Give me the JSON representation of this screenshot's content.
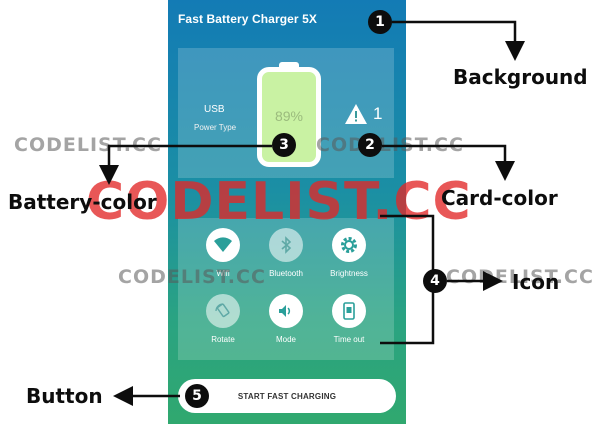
{
  "app": {
    "title": "Fast Battery Charger 5X",
    "power_type_value": "USB",
    "power_type_label": "Power Type",
    "battery_percent": "89%",
    "warning_count": "1",
    "start_button": "START FAST CHARGING"
  },
  "tiles": [
    {
      "label": "Wifi",
      "icon": "wifi-icon"
    },
    {
      "label": "Bluetooth",
      "icon": "bluetooth-icon"
    },
    {
      "label": "Brightness",
      "icon": "brightness-gear-icon"
    },
    {
      "label": "Rotate",
      "icon": "rotate-icon"
    },
    {
      "label": "Mode",
      "icon": "volume-icon"
    },
    {
      "label": "Time out",
      "icon": "phone-timeout-icon"
    }
  ],
  "annotations": {
    "badges": [
      "1",
      "2",
      "3",
      "4",
      "5"
    ],
    "labels": {
      "background": "Background",
      "card_color": "Card-color",
      "battery_color": "Battery-color",
      "icon": "Icon",
      "button": "Button"
    }
  },
  "watermarks": {
    "gray": "CODELIST.CC",
    "red": "CODELIST.CC"
  },
  "colors": {
    "background_top": "#137bb5",
    "background_bottom": "#30a86f",
    "battery_fill": "#c9f2a3",
    "watermark_red": "#e12828"
  }
}
